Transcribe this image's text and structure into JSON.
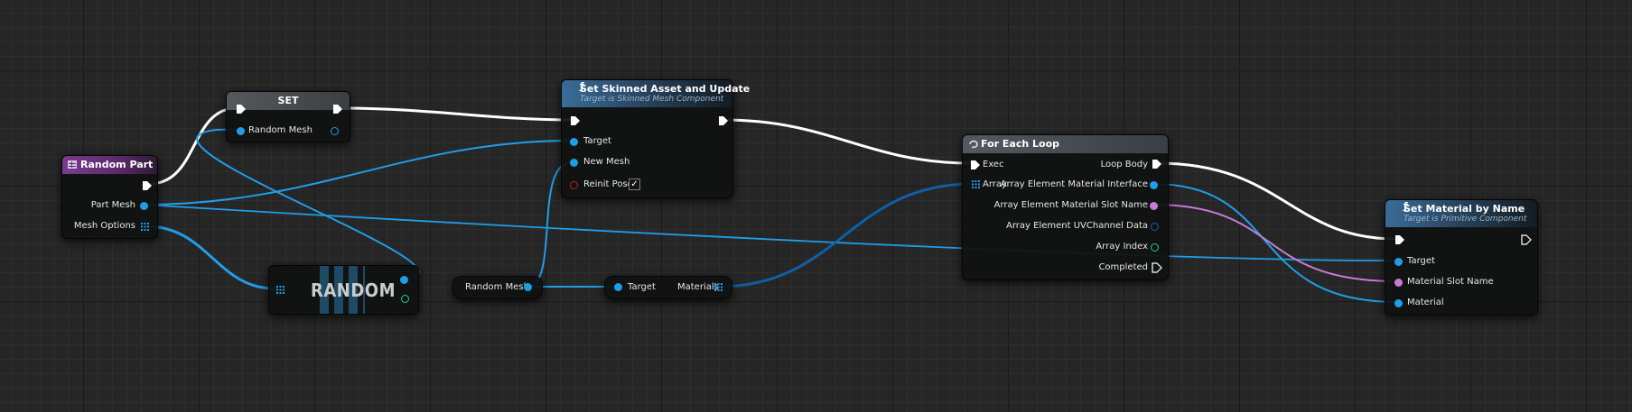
{
  "graph": {
    "nodes": {
      "random_part": {
        "title": "Random Part",
        "pins": {
          "part_mesh": "Part Mesh",
          "mesh_options": "Mesh Options"
        }
      },
      "set": {
        "title": "SET",
        "pins": {
          "random_mesh": "Random Mesh"
        }
      },
      "random": {
        "title": "RANDOM"
      },
      "random_mesh_getter": {
        "label": "Random Mesh"
      },
      "materials_getter": {
        "target": "Target",
        "materials": "Materials"
      },
      "set_skinned_asset": {
        "title": "Set Skinned Asset and Update",
        "subtitle": "Target is Skinned Mesh Component",
        "pins": {
          "target": "Target",
          "new_mesh": "New Mesh",
          "reinit_pose": "Reinit Pose"
        },
        "reinit_pose_checked": true
      },
      "for_each_loop": {
        "title": "For Each Loop",
        "pins": {
          "exec": "Exec",
          "array": "Array",
          "loop_body": "Loop Body",
          "array_element_material_interface": "Array Element Material Interface",
          "array_element_material_slot_name": "Array Element Material Slot Name",
          "array_element_uvchannel_data": "Array Element UVChannel Data",
          "array_index": "Array Index",
          "completed": "Completed"
        }
      },
      "set_material_by_name": {
        "title": "Set Material by Name",
        "subtitle": "Target is Primitive Component",
        "pins": {
          "target": "Target",
          "material_slot_name": "Material Slot Name",
          "material": "Material"
        }
      }
    },
    "colors": {
      "exec_wire": "#ffffff",
      "object_wire": "#1f9ee8",
      "name_wire": "#c67bd5",
      "int_pin": "#1ec9a0",
      "bool_pin": "#8e1a1a",
      "struct_pin": "#0f5fa8",
      "function_header": "#3a6c98",
      "variable_header": "#7a3b8e",
      "macro_header": "#53595e"
    }
  }
}
